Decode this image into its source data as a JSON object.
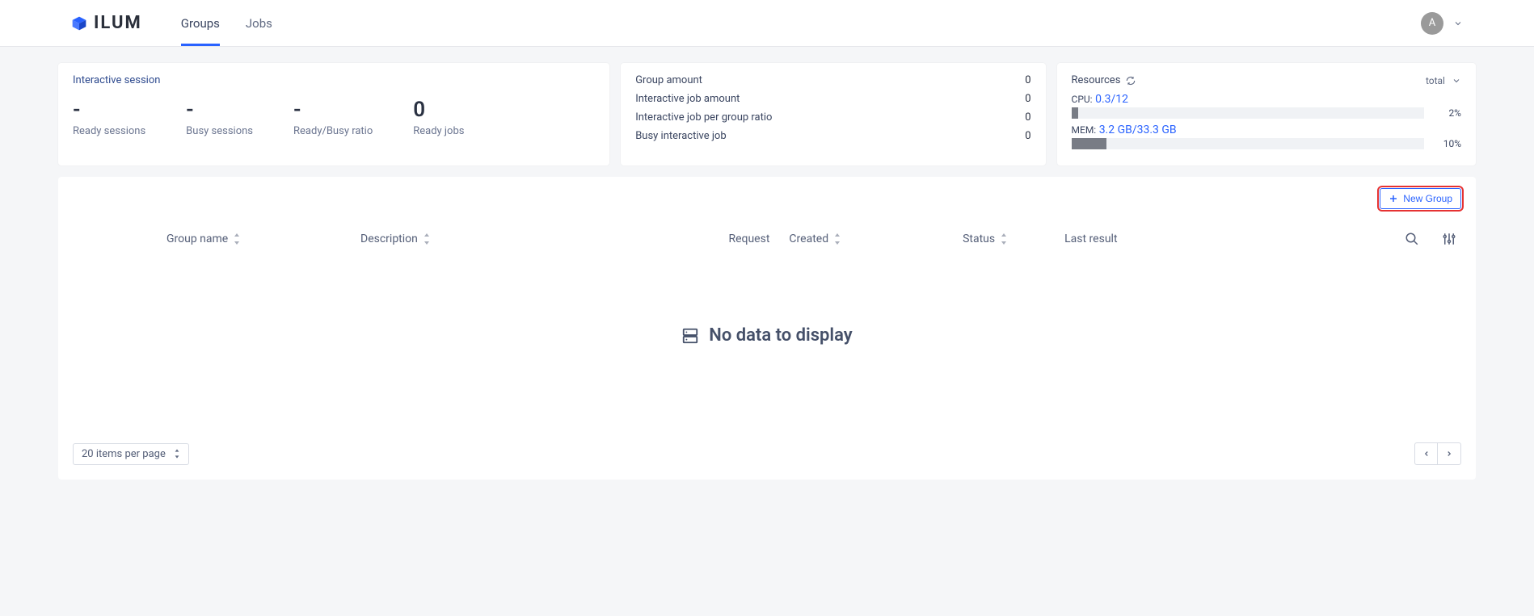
{
  "brand": {
    "name": "ILUM"
  },
  "nav": {
    "groups": "Groups",
    "jobs": "Jobs",
    "active": "groups"
  },
  "user": {
    "initial": "A"
  },
  "session": {
    "title": "Interactive session",
    "stats": [
      {
        "value": "-",
        "label": "Ready sessions"
      },
      {
        "value": "-",
        "label": "Busy sessions"
      },
      {
        "value": "-",
        "label": "Ready/Busy ratio"
      },
      {
        "value": "0",
        "label": "Ready jobs"
      }
    ]
  },
  "metrics": [
    {
      "label": "Group amount",
      "value": "0"
    },
    {
      "label": "Interactive job amount",
      "value": "0"
    },
    {
      "label": "Interactive job per group ratio",
      "value": "0"
    },
    {
      "label": "Busy interactive job",
      "value": "0"
    }
  ],
  "resources": {
    "title": "Resources",
    "scope": "total",
    "cpu": {
      "label": "CPU:",
      "value": "0.3/12",
      "pct": "2%",
      "fill": 2
    },
    "mem": {
      "label": "MEM:",
      "value": "3.2 GB/33.3 GB",
      "pct": "10%",
      "fill": 10
    }
  },
  "table": {
    "newGroupLabel": "New Group",
    "columns": {
      "group": "Group name",
      "description": "Description",
      "request": "Request",
      "created": "Created",
      "status": "Status",
      "lastResult": "Last result"
    },
    "emptyText": "No data to display",
    "pageSize": "20 items per page"
  }
}
